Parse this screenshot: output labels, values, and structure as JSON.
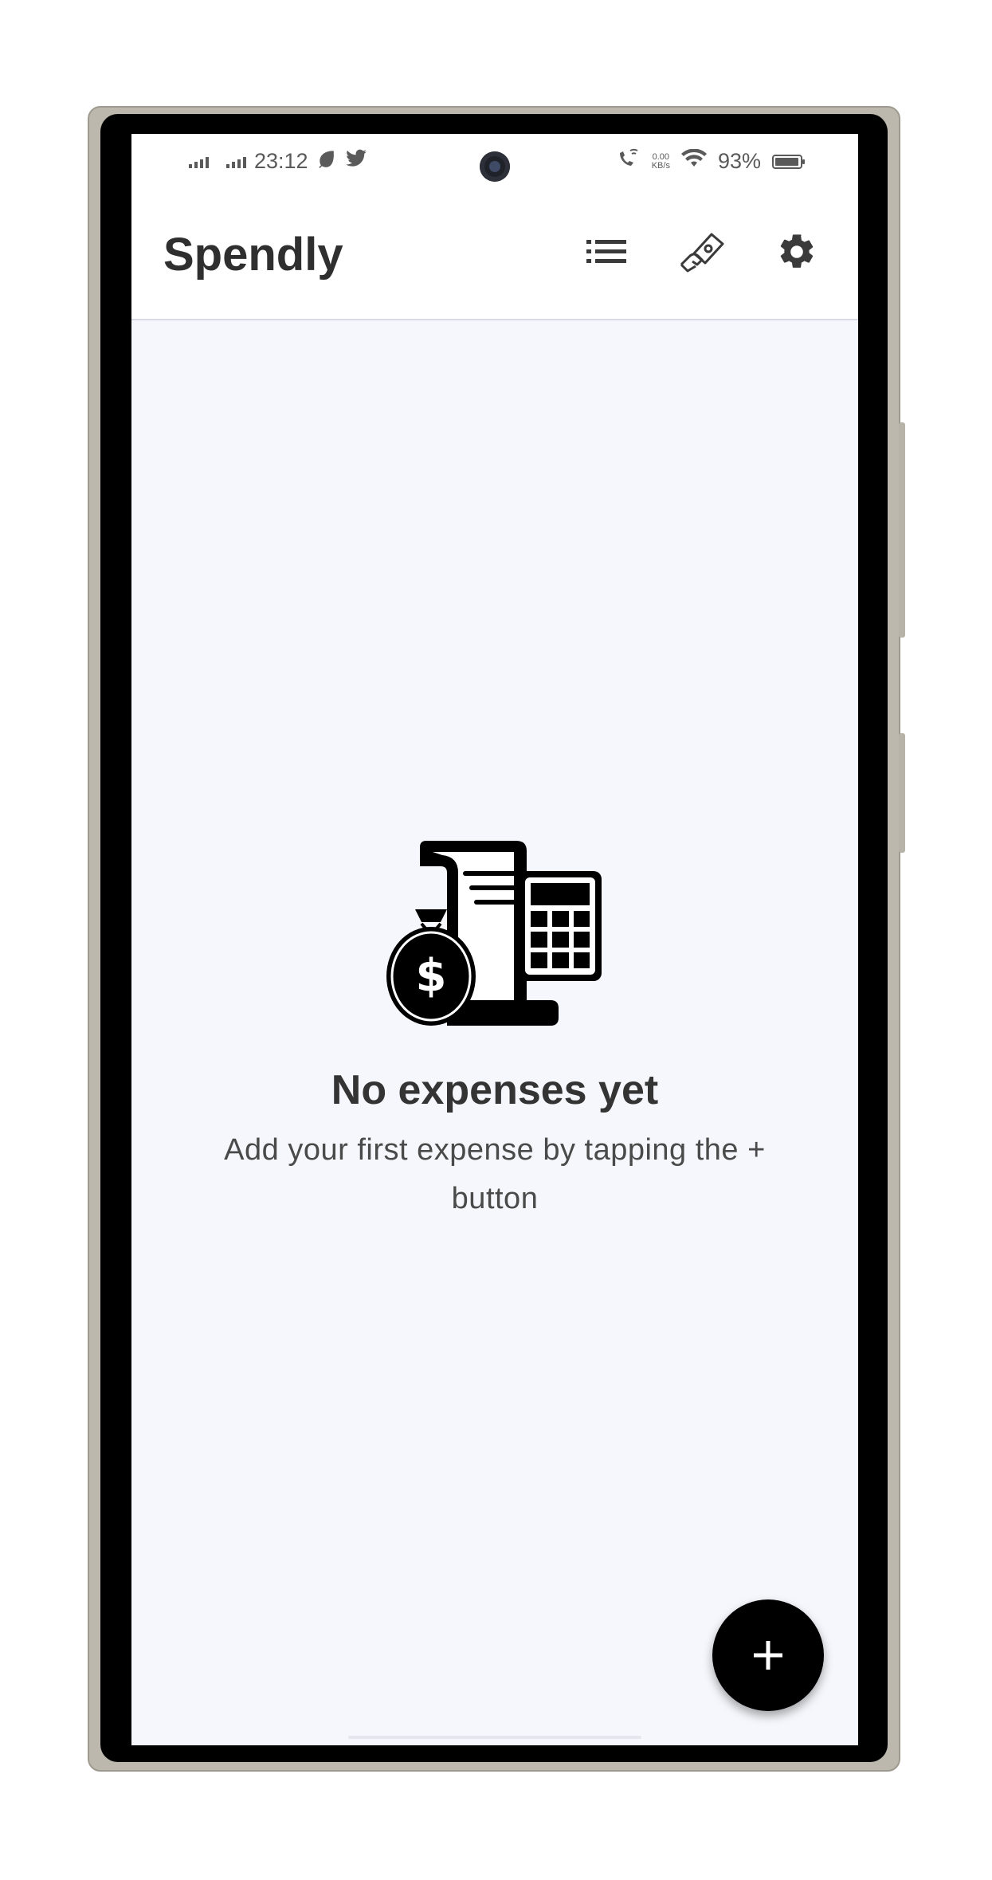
{
  "status_bar": {
    "time": "23:12",
    "data_speed_value": "0.00",
    "data_speed_unit": "KB/s",
    "battery_percent": "93%",
    "icons": [
      "signal-icon",
      "signal-icon",
      "leaf-icon",
      "twitter-icon",
      "wifi-call-icon",
      "wifi-icon",
      "battery-icon"
    ]
  },
  "app_bar": {
    "title": "Spendly",
    "actions": [
      "list-icon",
      "hand-money-icon",
      "gear-icon"
    ]
  },
  "empty_state": {
    "illustration": "money-bag-receipt-calculator-icon",
    "title": "No expenses yet",
    "subtitle": "Add your first expense by tapping the + button"
  },
  "fab": {
    "label": "+",
    "icon": "plus-icon"
  },
  "colors": {
    "background": "#f6f7fc",
    "appbar": "#ffffff",
    "text_primary": "#2f2f2f",
    "fab": "#000000"
  }
}
